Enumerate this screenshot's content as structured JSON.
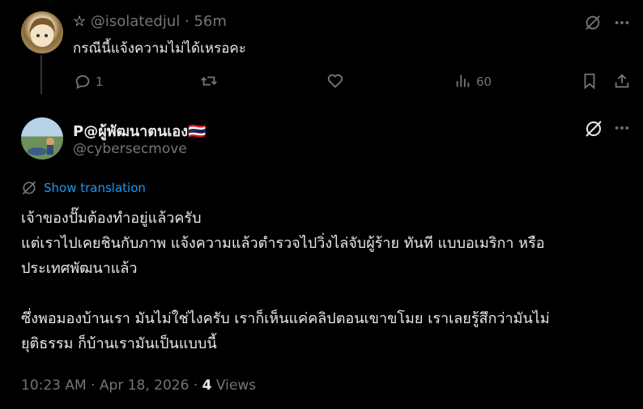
{
  "reply": {
    "star": "☆",
    "handle": "@isolatedjul",
    "sep": "·",
    "time": "56m",
    "text": "กรณีนี้แจ้งความไม่ได้เหรอคะ",
    "reply_count": "1",
    "view_count": "60"
  },
  "main": {
    "display_name": "P@ผู้พัฒนาตนเอง",
    "flag": "🇹🇭",
    "handle": "@cybersecmove",
    "translate_label": "Show translation",
    "lines": [
      "เจ้าของปั๊มต้องทำอยู่แล้วครับ",
      "แต่เราไปเคยชินกับภาพ แจ้งความแล้วตำรวจไปวิ่งไล่จับผู้ร้าย ทันที แบบอเมริกา หรือ",
      "ประเทศพัฒนาแล้ว",
      "",
      "ซึ่งพอมองบ้านเรา มันไม่ใช่ไงครับ เราก็เห็นแค่คลิปตอนเขาขโมย เราเลยรู้สึกว่ามันไม่",
      "ยุติธรรม ก็บ้านเรามันเป็นแบบนี้"
    ],
    "timestamp": "10:23 AM · Apr 18, 2026 · ",
    "views_count": "4",
    "views_label": " Views"
  },
  "colors": {
    "link": "#1d9bf0",
    "muted": "#71767b",
    "text": "#e7e9ea",
    "bg": "#000000"
  },
  "icons": [
    "grok-icon",
    "more-icon",
    "reply-icon",
    "retweet-icon",
    "like-icon",
    "views-icon",
    "bookmark-icon",
    "share-icon",
    "translate-icon"
  ]
}
